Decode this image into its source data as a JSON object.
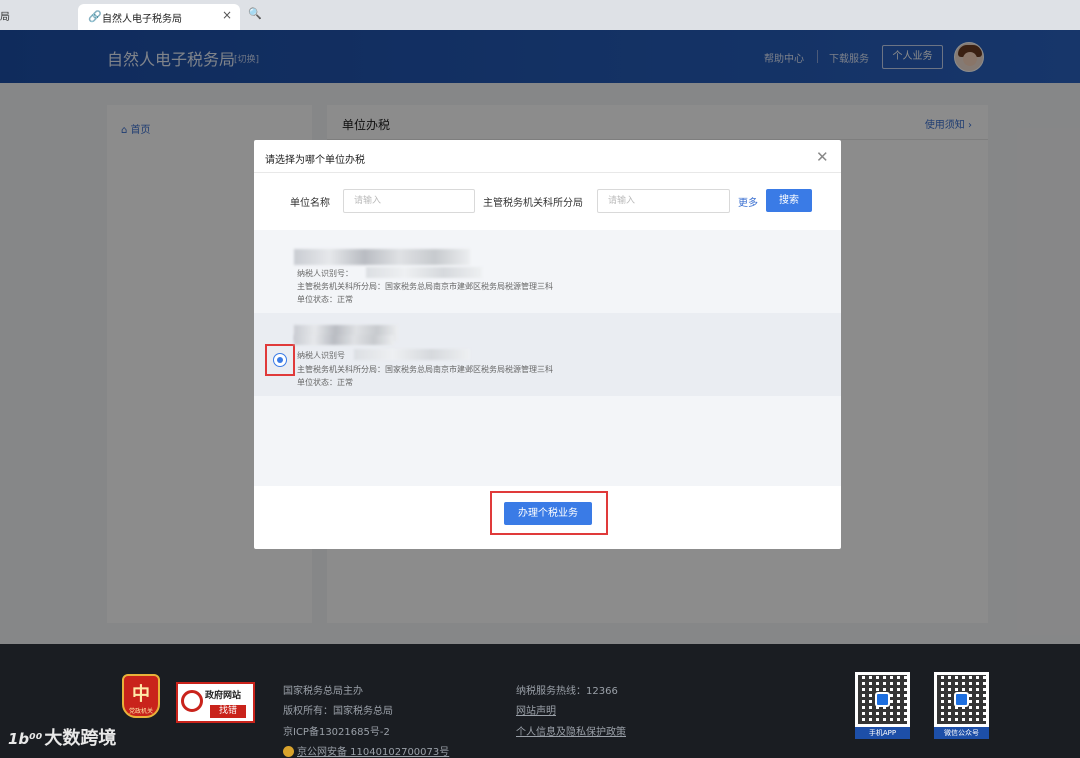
{
  "browser": {
    "prev_tab_fragment": "局",
    "active_tab_title": "自然人电子税务局",
    "close_glyph": "×",
    "search_glyph": "🔍"
  },
  "header": {
    "site_title": "自然人电子税务局",
    "switch_label": "[切换]",
    "help_center": "帮助中心",
    "download_service": "下载服务",
    "personal_business": "个人业务"
  },
  "sidebar": {
    "home_label": "首页",
    "home_icon": "⌂"
  },
  "main": {
    "title": "单位办税",
    "notice_link": "使用须知 ›"
  },
  "modal": {
    "title": "请选择为哪个单位办税",
    "close_glyph": "✕",
    "filters": {
      "unit_name_label": "单位名称",
      "unit_name_placeholder": "请输入",
      "tax_office_label": "主管税务机关科所分局",
      "tax_office_placeholder": "请输入",
      "more_label": "更多",
      "search_button": "搜索"
    },
    "units": [
      {
        "taxpayer_id_label": "纳税人识别号：",
        "tax_office_line": "主管税务机关科所分局：国家税务总局南京市建邺区税务局税源管理三科",
        "status_line": "单位状态：正常",
        "selected": false
      },
      {
        "taxpayer_id_label": "纳税人识别号",
        "tax_office_line": "主管税务机关科所分局：国家税务总局南京市建邺区税务局税源管理三科",
        "status_line": "单位状态：正常",
        "selected": true
      }
    ],
    "action_button": "办理个税业务"
  },
  "footer": {
    "emblem_glyph": "中",
    "emblem_label": "党政机关",
    "gov_site_title": "政府网站",
    "gov_site_tag": "找错",
    "sponsor": "国家税务总局主办",
    "copyright": "版权所有：国家税务总局",
    "icp": "京ICP备13021685号-2",
    "police_record": "京公网安备 11040102700073号",
    "hotline": "纳税服务热线：12366",
    "site_statement": "网站声明",
    "privacy_policy": "个人信息及隐私保护政策",
    "qr_mobile_label": "手机APP",
    "qr_wechat_label": "微信公众号"
  },
  "watermark": {
    "logo": "1b⁰⁰",
    "text": "大数跨境"
  }
}
